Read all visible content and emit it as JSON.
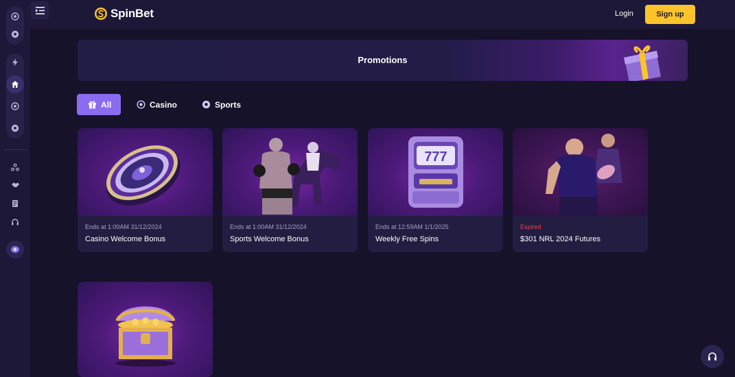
{
  "brand": {
    "name": "SpinBet",
    "accent": "#fcc42a",
    "primary": "#8a6cf0"
  },
  "header": {
    "login_label": "Login",
    "signup_label": "Sign up",
    "menu_icon": "menu-collapse-icon"
  },
  "sidebar": {
    "top_group": [
      "casino-chip-icon",
      "soccer-ball-icon"
    ],
    "items": [
      "lightning-icon",
      "home-icon",
      "casino-chip-icon",
      "soccer-ball-icon"
    ],
    "secondary": [
      "network-icon",
      "handshake-icon",
      "notes-icon",
      "headset-small-icon",
      "vip-icon"
    ]
  },
  "banner": {
    "title": "Promotions"
  },
  "tabs": [
    {
      "label": "All",
      "icon": "gift-icon",
      "active": true
    },
    {
      "label": "Casino",
      "icon": "casino-chip-icon",
      "active": false
    },
    {
      "label": "Sports",
      "icon": "soccer-ball-icon",
      "active": false
    }
  ],
  "promotions": [
    {
      "meta": "Ends at 1:00AM 31/12/2024",
      "title": "Casino Welcome Bonus",
      "image": "roulette-wheel"
    },
    {
      "meta": "Ends at 1:00AM 31/12/2024",
      "title": "Sports Welcome Bonus",
      "image": "boxer-and-jockey"
    },
    {
      "meta": "Ends at 12:59AM 1/1/2025",
      "title": "Weekly Free Spins",
      "image": "slot-machine-777"
    },
    {
      "meta": "Expired",
      "title": "$301 NRL 2024 Futures",
      "image": "rugby-players"
    },
    {
      "meta": "",
      "title": "",
      "image": "treasure-chest"
    }
  ],
  "support": {
    "icon": "headset-icon"
  }
}
